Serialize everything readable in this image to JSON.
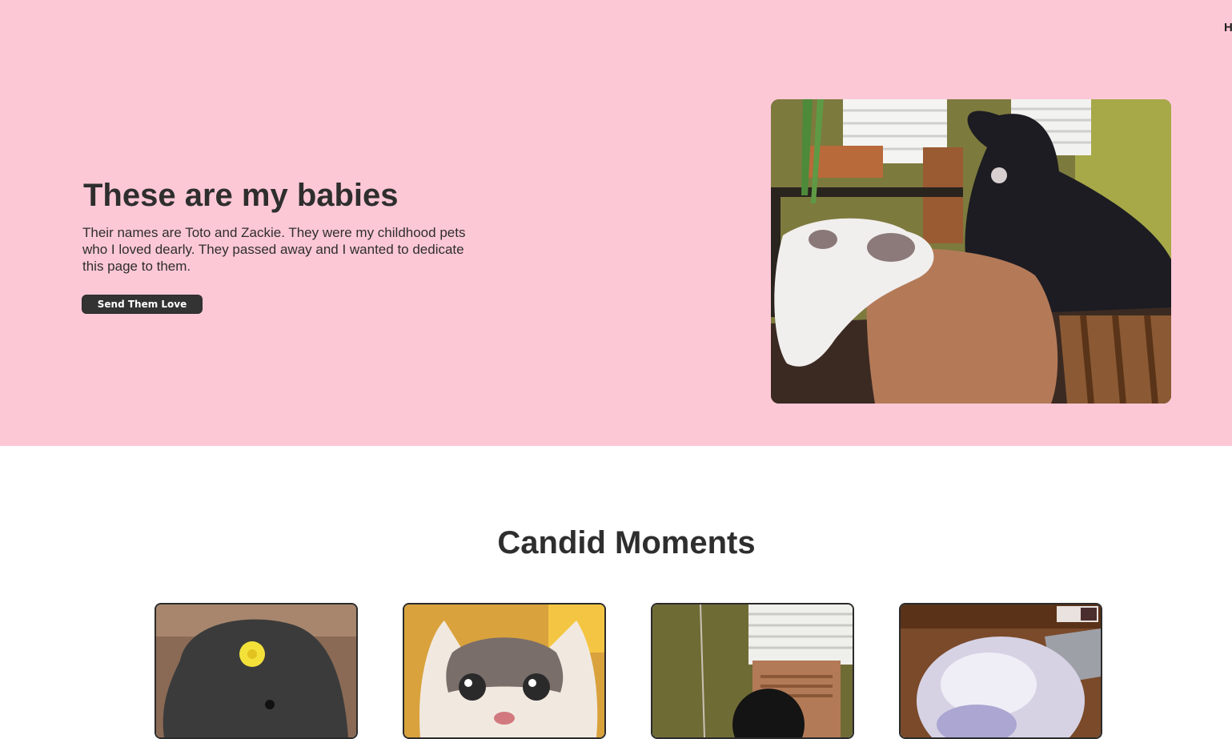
{
  "nav": {
    "home_label": "Home"
  },
  "hero": {
    "title": "These are my babies",
    "description": "Their names are Toto and Zackie. They were my childhood pets who I loved dearly. They passed away and I wanted to dedicate this page to them.",
    "button_label": "Send Them Love",
    "photo_icon": "cat-and-dog-on-couch-photo"
  },
  "gallery": {
    "title": "Candid Moments",
    "photos": [
      {
        "icon": "dog-with-flower-photo"
      },
      {
        "icon": "cat-closeup-photo"
      },
      {
        "icon": "dog-by-window-photo"
      },
      {
        "icon": "fluffy-cat-photo"
      }
    ]
  },
  "colors": {
    "hero_background": "#fdc8d6",
    "text": "#2e2e2e",
    "button": "#333333"
  }
}
